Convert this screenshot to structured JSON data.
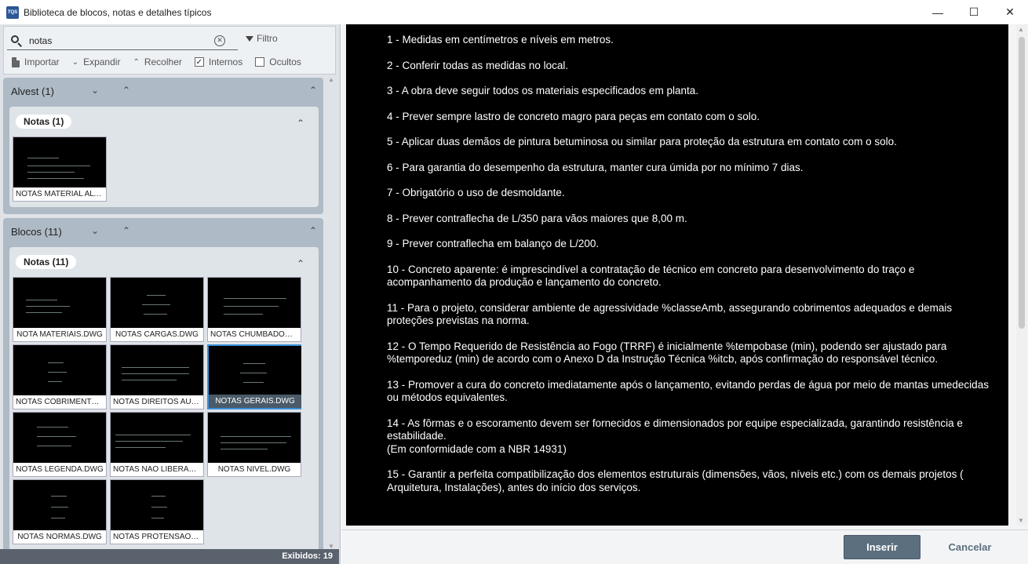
{
  "window": {
    "title": "Biblioteca de blocos, notas e detalhes típicos",
    "app_icon": "TQS"
  },
  "search": {
    "value": "notas",
    "placeholder": "",
    "filter_label": "Filtro"
  },
  "toolbar": {
    "import_label": "Importar",
    "expand_label": "Expandir",
    "collapse_label": "Recolher",
    "internal_label": "Internos",
    "internal_checked": true,
    "hidden_label": "Ocultos",
    "hidden_checked": false
  },
  "groups": [
    {
      "title": "Alvest (1)",
      "subgroups": [
        {
          "title": "Notas (1)",
          "items": [
            "NOTAS MATERIAL ALVE..."
          ]
        }
      ]
    },
    {
      "title": "Blocos (11)",
      "subgroups": [
        {
          "title": "Notas (11)",
          "items": [
            "NOTA MATERIAIS.DWG",
            "NOTAS CARGAS.DWG",
            "NOTAS CHUMBADOR.D...",
            "NOTAS COBRIMENTO.D...",
            "NOTAS DIREITOS AUTO...",
            "NOTAS GERAIS.DWG",
            "NOTAS LEGENDA.DWG",
            "NOTAS NAO LIBERADA...",
            "NOTAS NIVEL.DWG",
            "NOTAS NORMAS.DWG",
            "NOTAS PROTENSAO.D..."
          ],
          "selected_index": 5
        }
      ]
    }
  ],
  "status": {
    "shown": "Exibidos: 19"
  },
  "notes": [
    "1 - Medidas em centímetros e níveis em metros.",
    "2 - Conferir todas as medidas no local.",
    "3 - A obra deve seguir todos os materiais especificados em planta.",
    "4 - Prever sempre lastro de concreto magro para peças em contato com o solo.",
    "5 - Aplicar duas demãos de pintura betuminosa ou similar para proteção da estrutura em contato com o solo.",
    "6 - Para garantia do desempenho da estrutura, manter cura úmida por no mínimo 7 dias.",
    "7 - Obrigatório o uso de desmoldante.",
    "8 - Prever contraflecha de L/350 para vãos maiores que 8,00 m.",
    "9 - Prever contraflecha em balanço de L/200.",
    "10 - Concreto aparente: é imprescindível a contratação de técnico em concreto para desenvolvimento do traço e acompanhamento da produção e lançamento do concreto.",
    "11 - Para o projeto, considerar ambiente de agressividade %classeAmb, assegurando cobrimentos adequados e demais proteções previstas na norma.",
    "12 - O Tempo Requerido de Resistência ao Fogo (TRRF) é inicialmente %tempobase (min), podendo ser ajustado para %temporeduz (min) de acordo com o Anexo D da Instrução Técnica %itcb, após confirmação do responsável técnico.",
    "13 - Promover a cura do concreto imediatamente após o lançamento, evitando perdas de água por meio de mantas umedecidas ou métodos equivalentes.",
    "14 - As fôrmas e o escoramento devem ser fornecidos e dimensionados por equipe especializada, garantindo resistência e estabilidade.\n(Em conformidade com a NBR 14931)",
    "15 - Garantir a perfeita compatibilização dos elementos estruturais (dimensões, vãos, níveis etc.) com os demais projetos ( Arquitetura, Instalações), antes do início dos serviços."
  ],
  "footer": {
    "insert_label": "Inserir",
    "cancel_label": "Cancelar"
  },
  "colors": {
    "accent": "#5b6f7f",
    "panel": "#dfe3e8",
    "group": "#aebac5",
    "selection": "#3b8fd8"
  },
  "icons": {
    "search": "search-icon",
    "clear": "clear-icon",
    "filter": "filter-icon",
    "import": "document-icon"
  }
}
